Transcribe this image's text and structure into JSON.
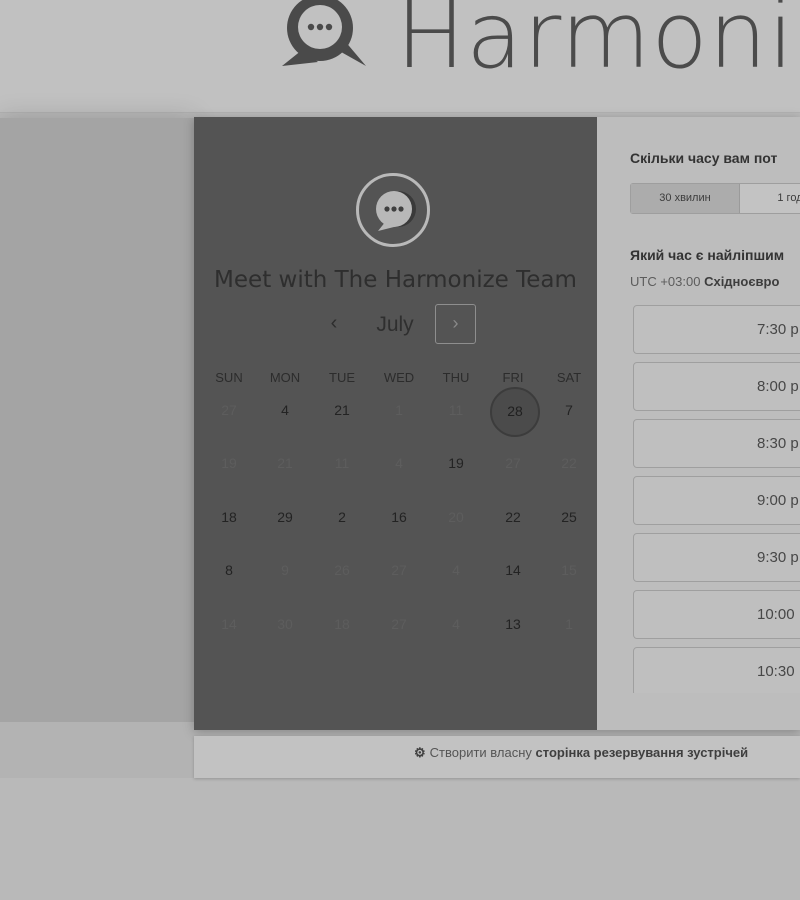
{
  "brand": {
    "name": "Harmoni"
  },
  "calendar": {
    "title": "Meet with The Harmonize Team",
    "month": "July",
    "prev_icon": "‹",
    "next_icon": "›",
    "weekdays": [
      "SUN",
      "MON",
      "TUE",
      "WED",
      "THU",
      "FRI",
      "SAT"
    ],
    "weeks": [
      [
        {
          "d": "27",
          "s": "dim"
        },
        {
          "d": "4",
          "s": "available"
        },
        {
          "d": "21",
          "s": "available"
        },
        {
          "d": "1",
          "s": "dim"
        },
        {
          "d": "11",
          "s": "dim"
        },
        {
          "d": "28",
          "s": "selected"
        },
        {
          "d": "7",
          "s": "available"
        }
      ],
      [
        {
          "d": "19",
          "s": "dim"
        },
        {
          "d": "21",
          "s": "dim"
        },
        {
          "d": "11",
          "s": "dim"
        },
        {
          "d": "4",
          "s": "dim"
        },
        {
          "d": "19",
          "s": "available"
        },
        {
          "d": "27",
          "s": "dim"
        },
        {
          "d": "22",
          "s": "dim"
        }
      ],
      [
        {
          "d": "18",
          "s": "available"
        },
        {
          "d": "29",
          "s": "available"
        },
        {
          "d": "2",
          "s": "available"
        },
        {
          "d": "16",
          "s": "available"
        },
        {
          "d": "20",
          "s": "dim"
        },
        {
          "d": "22",
          "s": "available"
        },
        {
          "d": "25",
          "s": "available"
        }
      ],
      [
        {
          "d": "8",
          "s": "available"
        },
        {
          "d": "9",
          "s": "dim"
        },
        {
          "d": "26",
          "s": "dim"
        },
        {
          "d": "27",
          "s": "dim"
        },
        {
          "d": "4",
          "s": "dim"
        },
        {
          "d": "14",
          "s": "available"
        },
        {
          "d": "15",
          "s": "dim"
        }
      ],
      [
        {
          "d": "14",
          "s": "dim"
        },
        {
          "d": "30",
          "s": "dim"
        },
        {
          "d": "18",
          "s": "dim"
        },
        {
          "d": "27",
          "s": "dim"
        },
        {
          "d": "4",
          "s": "dim"
        },
        {
          "d": "13",
          "s": "available"
        },
        {
          "d": "1",
          "s": "dim"
        }
      ]
    ]
  },
  "booking": {
    "duration_question": "Скільки часу вам пот",
    "durations": [
      "30 хвилин",
      "1 год"
    ],
    "time_question": "Який час є найліпшим",
    "timezone_prefix": "UTC +03:00",
    "timezone_name": "Східноєвро",
    "slots": [
      "7:30 р",
      "8:00 р",
      "8:30 р",
      "9:00 р",
      "9:30 р",
      "10:00",
      "10:30"
    ]
  },
  "footer": {
    "prefix": "Створити власну",
    "bold": "сторінка резервування зустрічей"
  },
  "colors": {
    "panel_dark": "#545454",
    "panel_light": "#bdbdbd",
    "backdrop": "#b9b9b9"
  }
}
